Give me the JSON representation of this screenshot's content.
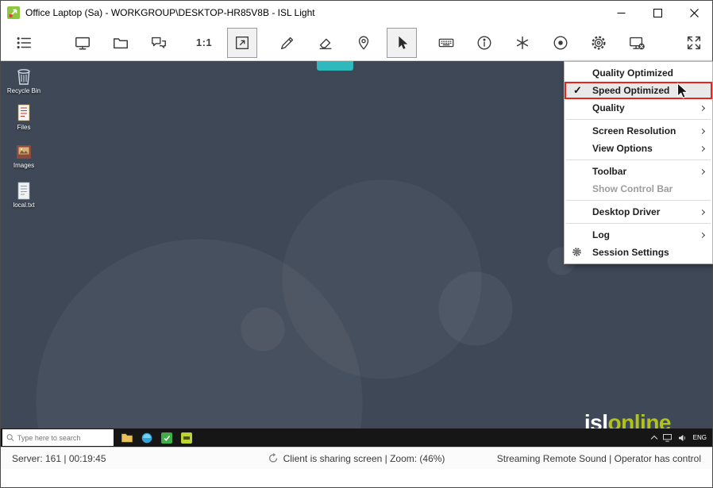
{
  "window": {
    "title": "Office Laptop (Sa) - WORKGROUP\\DESKTOP-HR85V8B - ISL Light"
  },
  "toolbar": {
    "scale_label": "1:1"
  },
  "menu": {
    "checkmark": "✓",
    "items": [
      {
        "label": "Quality Optimized"
      },
      {
        "label": "Speed Optimized"
      },
      {
        "label": "Quality"
      },
      {
        "label": "Screen Resolution"
      },
      {
        "label": "View Options"
      },
      {
        "label": "Toolbar"
      },
      {
        "label": "Show Control Bar"
      },
      {
        "label": "Desktop Driver"
      },
      {
        "label": "Log"
      },
      {
        "label": "Session Settings"
      }
    ]
  },
  "desktop": {
    "icons": [
      {
        "label": "Recycle Bin"
      },
      {
        "label": "Files"
      },
      {
        "label": "Images"
      },
      {
        "label": "local.txt"
      }
    ],
    "logo": {
      "part1": "isl",
      "part2": "online"
    }
  },
  "taskbar": {
    "search_placeholder": "Type here to search",
    "language": "ENG"
  },
  "statusbar": {
    "left": "Server: 161 | 00:19:45",
    "center": "Client is sharing screen  |  Zoom: (46%)",
    "right": "Streaming Remote Sound | Operator has control"
  }
}
